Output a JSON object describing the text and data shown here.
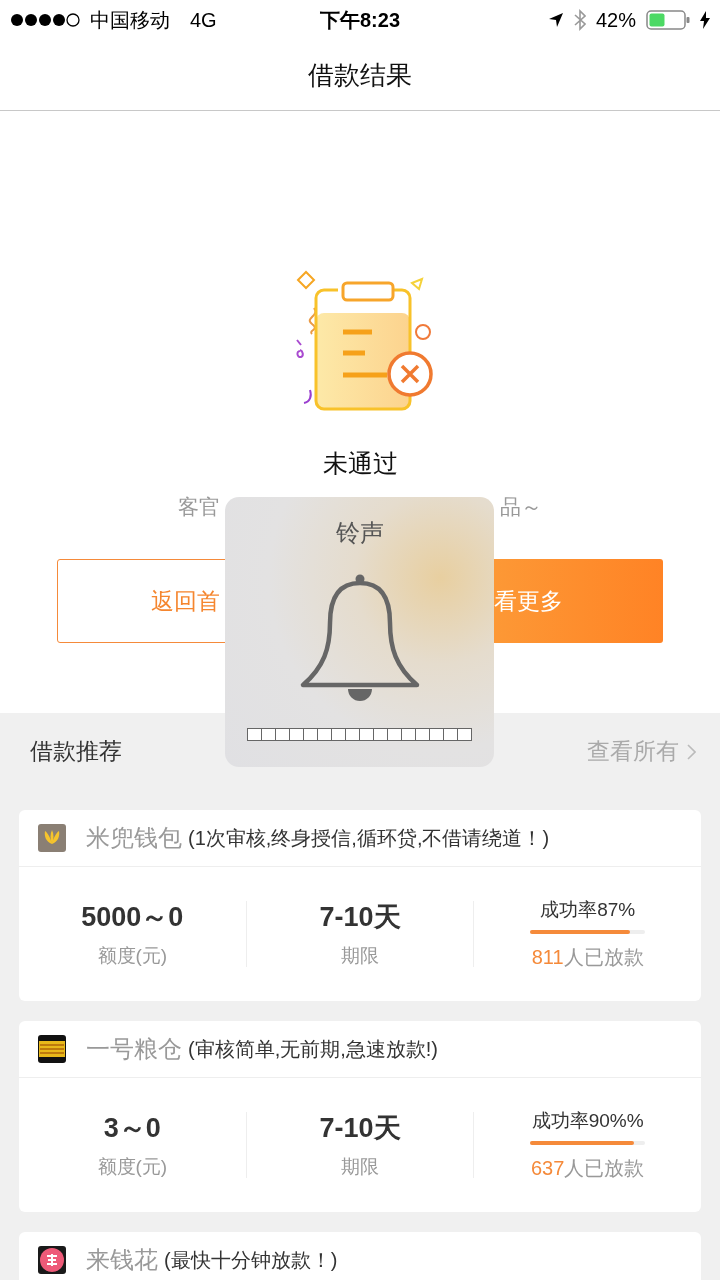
{
  "status_bar": {
    "carrier": "中国移动",
    "network": "4G",
    "time": "下午8:23",
    "battery": "42%"
  },
  "nav": {
    "title": "借款结果"
  },
  "result": {
    "title": "未通过",
    "subtitle_parts": [
      "客官",
      "品～"
    ]
  },
  "buttons": [
    {
      "kind": "outline",
      "label": "返回首"
    },
    {
      "kind": "filled",
      "label": "看更多"
    }
  ],
  "hud": {
    "title": "铃声",
    "level": 0
  },
  "section": {
    "title": "借款推荐",
    "link": "查看所有"
  },
  "products": [
    {
      "kind": "leaves",
      "name": "米兜钱包",
      "tagline": "(1次审核,终身授信,循环贷,不借请绕道！)",
      "amount": "5000～0",
      "amount_label": "额度(元)",
      "term": "7-10天",
      "term_label": "期限",
      "rate": "成功率87%",
      "level": 0.87,
      "count": "811",
      "count_suffix": "人已放款"
    },
    {
      "kind": "banner",
      "name": "一号粮仓",
      "tagline": "(审核简单,无前期,急速放款!)",
      "amount": "3～0",
      "amount_label": "额度(元)",
      "term": "7-10天",
      "term_label": "期限",
      "rate": "成功率90%%",
      "level": 0.9,
      "count": "637",
      "count_suffix": "人已放款"
    },
    {
      "kind": "flower",
      "name": "来钱花",
      "tagline": "(最快十分钟放款！)"
    }
  ]
}
